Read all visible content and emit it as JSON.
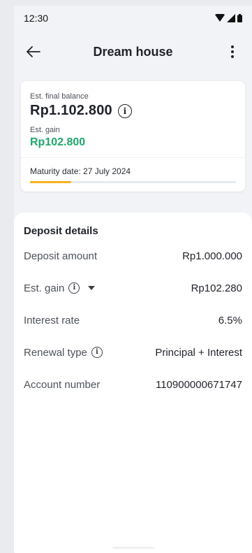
{
  "status_bar": {
    "time": "12:30"
  },
  "header": {
    "title": "Dream house"
  },
  "summary": {
    "final_balance_label": "Est. final balance",
    "final_balance": "Rp1.102.800",
    "gain_label": "Est. gain",
    "gain_value": "Rp102.800",
    "maturity": "Maturity date: 27 July 2024",
    "progress_fraction": 0.2
  },
  "details": {
    "heading": "Deposit details",
    "rows": [
      {
        "label": "Deposit amount",
        "value": "Rp1.000.000"
      },
      {
        "label": "Est. gain",
        "value": "Rp102.280"
      },
      {
        "label": "Interest rate",
        "value": "6.5%"
      },
      {
        "label": "Renewal type",
        "value": "Principal + Interest"
      },
      {
        "label": "Account number",
        "value": "110900000671747"
      }
    ]
  },
  "colors": {
    "accent_green": "#1ea76b",
    "progress": "#f5b21b"
  },
  "icons": [
    "back-arrow-icon",
    "more-vert-icon",
    "info-icon",
    "caret-down-icon",
    "wifi-icon",
    "signal-icon",
    "battery-icon"
  ]
}
